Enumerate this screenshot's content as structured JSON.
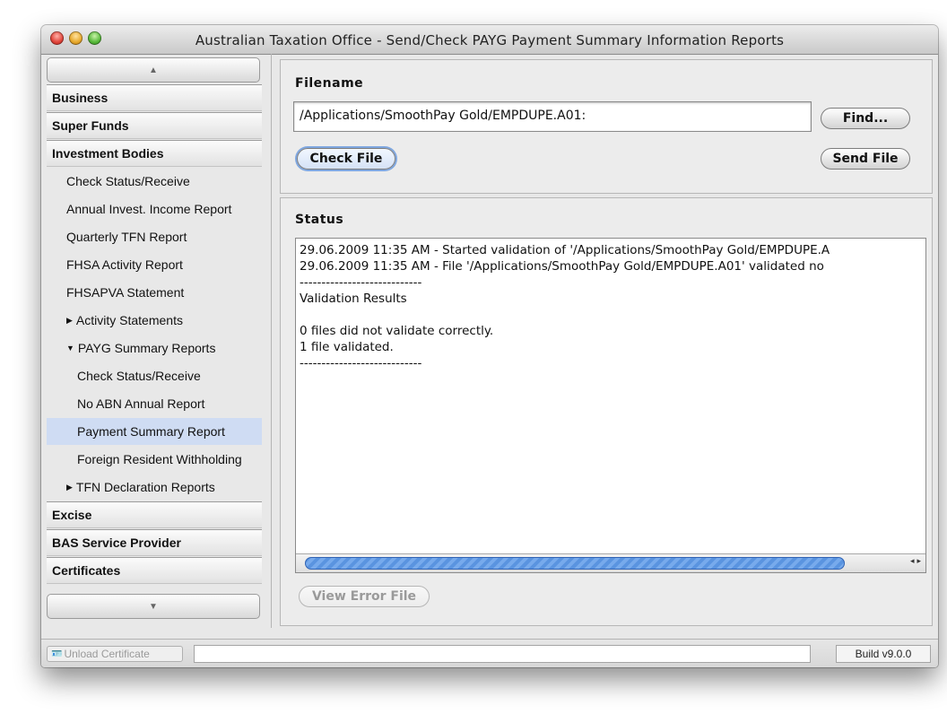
{
  "window": {
    "title": "Australian Taxation Office - Send/Check PAYG Payment Summary Information Reports"
  },
  "sidebar": {
    "scroll_up_icon": "triangle-up-icon",
    "scroll_down_icon": "triangle-down-icon",
    "items": [
      {
        "label": "Business",
        "kind": "header"
      },
      {
        "label": "Super Funds",
        "kind": "header"
      },
      {
        "label": "Investment Bodies",
        "kind": "header"
      },
      {
        "label": "Check Status/Receive",
        "kind": "item"
      },
      {
        "label": "Annual Invest. Income Report",
        "kind": "item"
      },
      {
        "label": "Quarterly TFN Report",
        "kind": "item"
      },
      {
        "label": "FHSA Activity Report",
        "kind": "item"
      },
      {
        "label": "FHSAPVA Statement",
        "kind": "item"
      },
      {
        "label": "Activity Statements",
        "kind": "group",
        "expanded": false
      },
      {
        "label": "PAYG Summary Reports",
        "kind": "group",
        "expanded": true
      },
      {
        "label": "Check Status/Receive",
        "kind": "subitem"
      },
      {
        "label": "No ABN Annual Report",
        "kind": "subitem"
      },
      {
        "label": "Payment Summary Report",
        "kind": "subitem",
        "selected": true
      },
      {
        "label": "Foreign Resident Withholding",
        "kind": "subitem"
      },
      {
        "label": "TFN Declaration Reports",
        "kind": "group",
        "expanded": false
      },
      {
        "label": "Excise",
        "kind": "header"
      },
      {
        "label": "BAS Service Provider",
        "kind": "header"
      },
      {
        "label": "Certificates",
        "kind": "header"
      }
    ]
  },
  "filename_pane": {
    "label": "Filename",
    "value": "/Applications/SmoothPay Gold/EMPDUPE.A01:",
    "find_button": "Find...",
    "check_button": "Check File",
    "send_button": "Send File"
  },
  "status_pane": {
    "label": "Status",
    "lines": [
      "29.06.2009 11:35 AM - Started validation of '/Applications/SmoothPay Gold/EMPDUPE.A",
      "29.06.2009 11:35 AM - File '/Applications/SmoothPay Gold/EMPDUPE.A01' validated no",
      "----------------------------",
      "Validation Results",
      "",
      "0 files did not validate correctly.",
      "1 file validated.",
      "----------------------------"
    ],
    "view_error_button": "View Error File"
  },
  "bottom_bar": {
    "unload_button": "Unload Certificate",
    "build": "Build v9.0.0"
  }
}
